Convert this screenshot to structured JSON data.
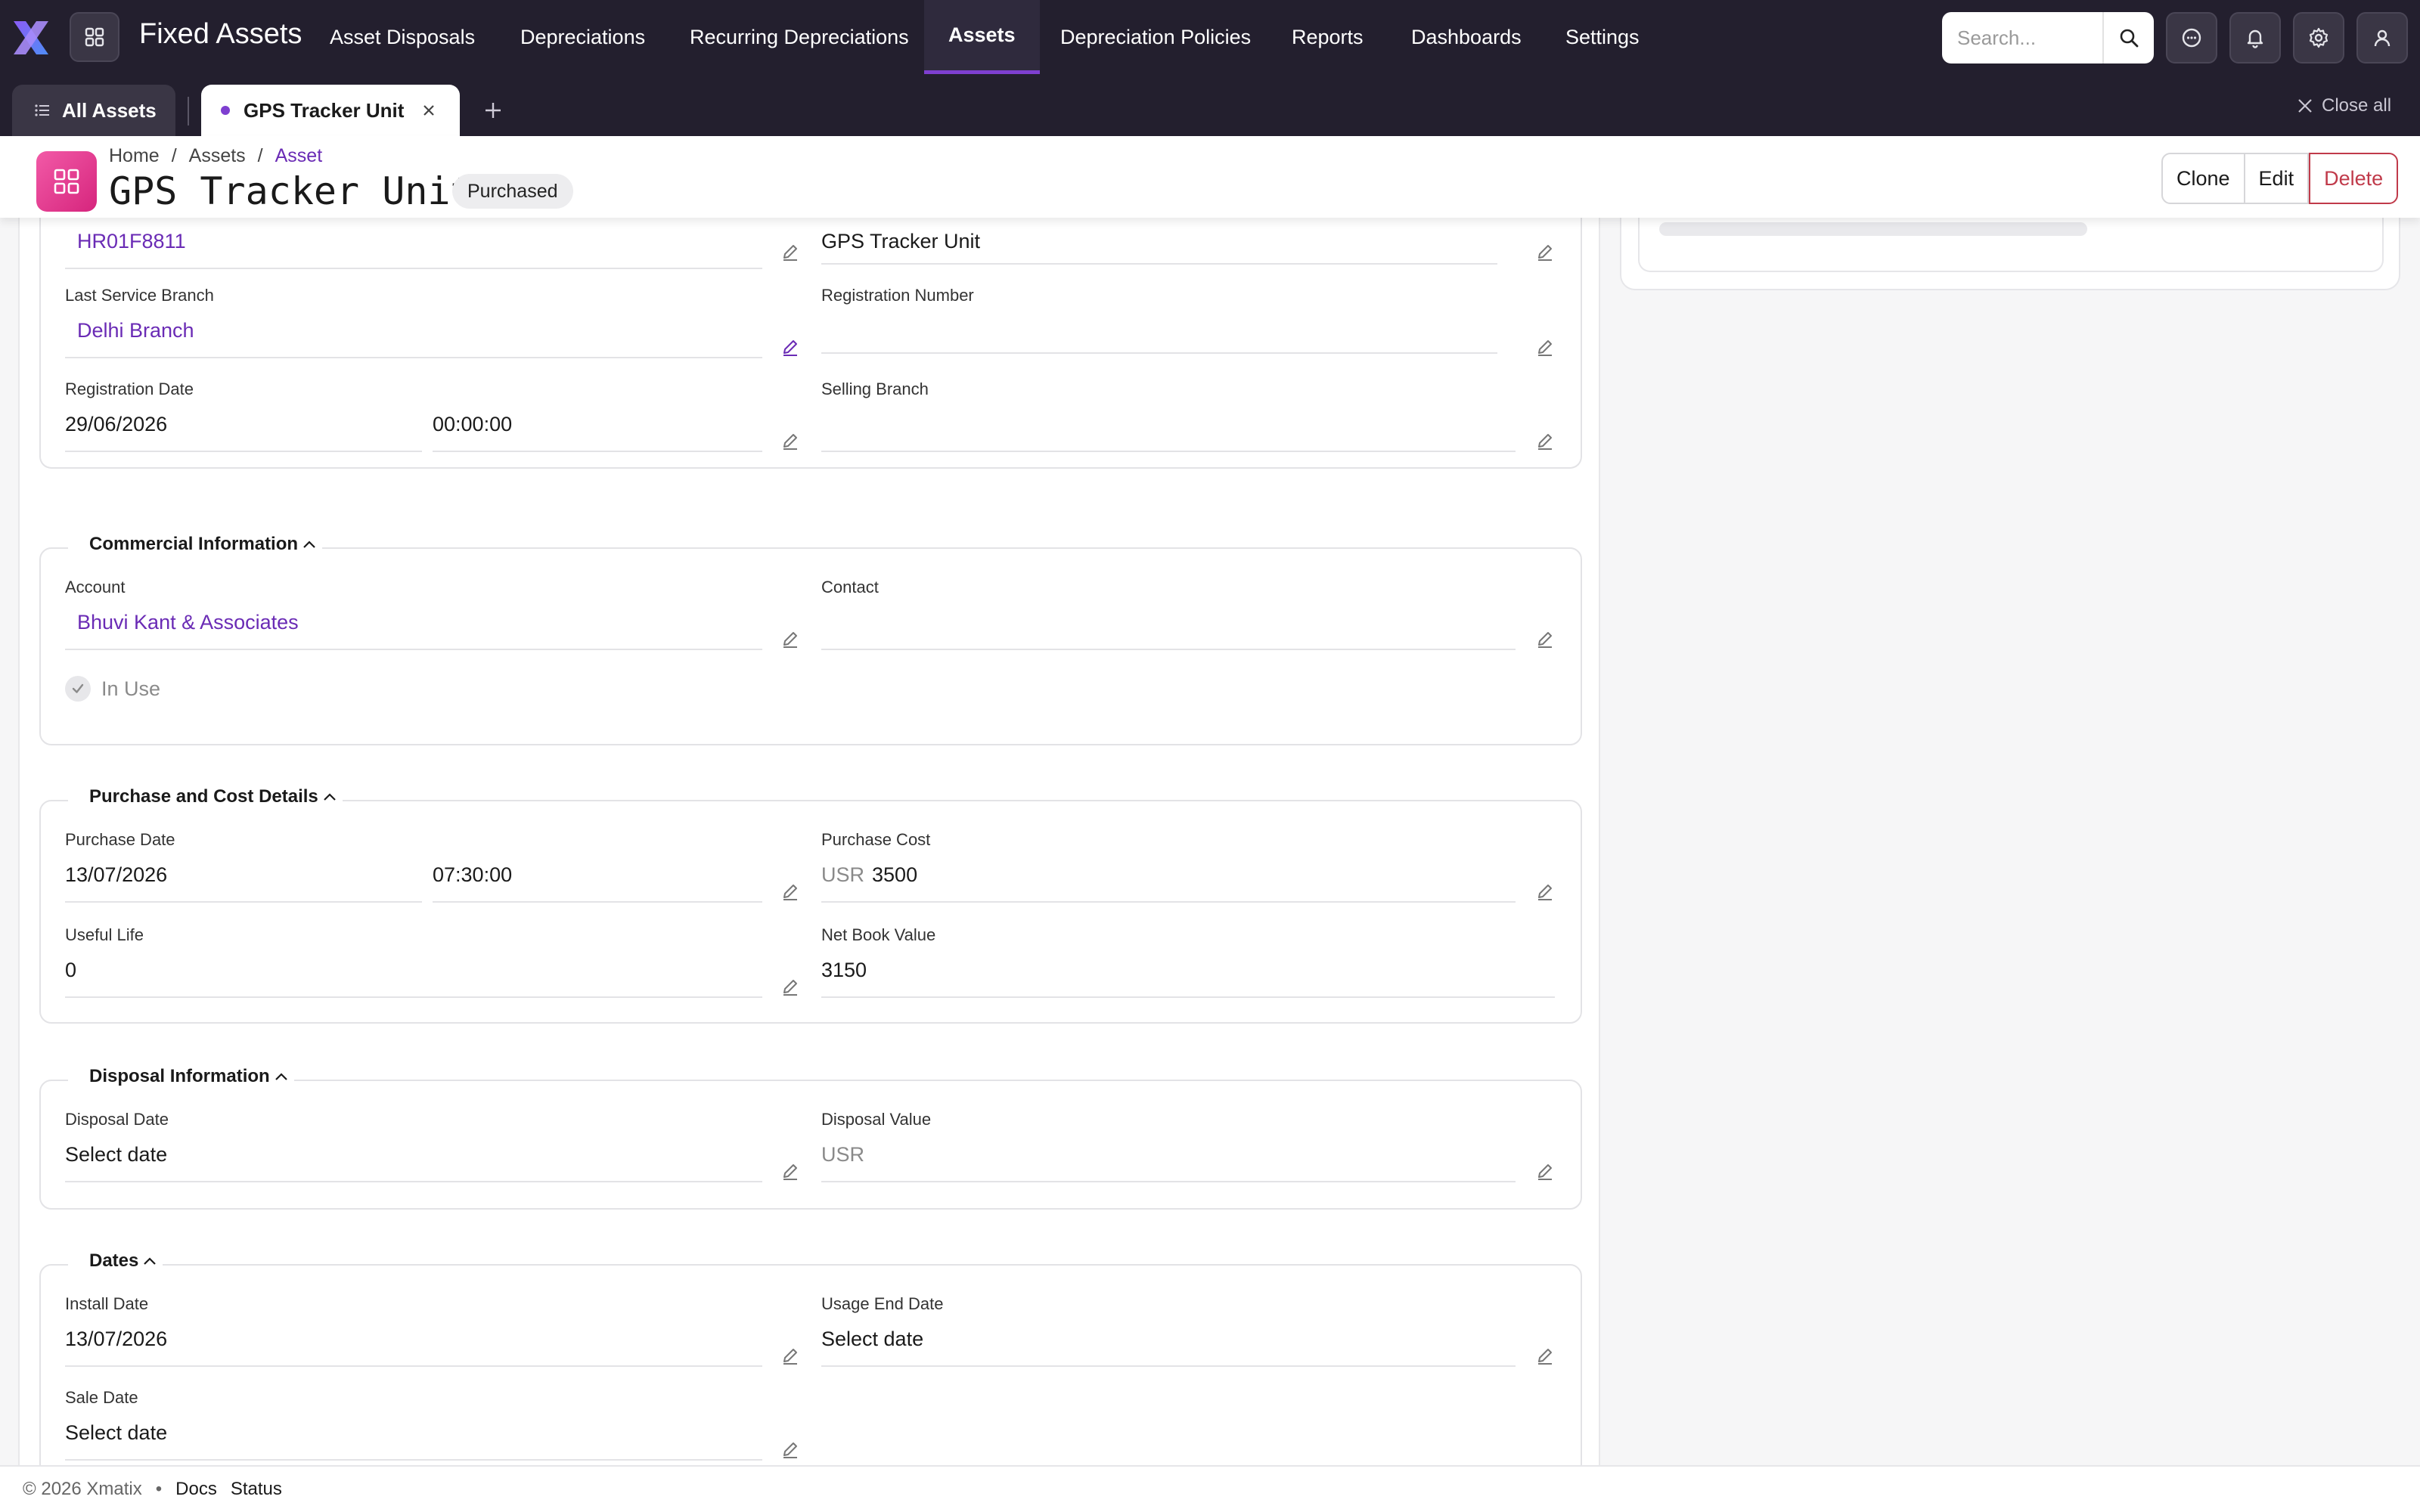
{
  "app": {
    "title": "Fixed Assets",
    "nav": [
      "Asset Disposals",
      "Depreciations",
      "Recurring Depreciations",
      "Assets",
      "Depreciation Policies",
      "Reports",
      "Dashboards",
      "Settings"
    ],
    "active_nav": "Assets",
    "search_placeholder": "Search...",
    "accent_color": "#7e3fd0",
    "icons": [
      "logo-x-icon",
      "app-grid-icon",
      "search-icon",
      "chat-icon",
      "bell-icon",
      "gear-icon",
      "user-icon"
    ]
  },
  "tabs": {
    "all_label": "All Assets",
    "current_label": "GPS Tracker Unit",
    "close_all": "Close all"
  },
  "header": {
    "breadcrumb": [
      "Home",
      "Assets",
      "Asset"
    ],
    "title": "GPS Tracker Unit",
    "status": "Purchased",
    "actions": {
      "clone": "Clone",
      "edit": "Edit",
      "delete": "Delete"
    }
  },
  "top_section": {
    "vehicle_number": "HR01F8811",
    "asset_name": "GPS Tracker Unit",
    "last_service_branch": {
      "label": "Last Service Branch",
      "value": "Delhi Branch"
    },
    "registration_number": {
      "label": "Registration Number",
      "value": ""
    },
    "registration_date": {
      "label": "Registration Date",
      "date": "29/06/2026",
      "time": "00:00:00"
    },
    "selling_branch": {
      "label": "Selling Branch",
      "value": ""
    }
  },
  "commercial": {
    "title": "Commercial Information",
    "account": {
      "label": "Account",
      "value": "Bhuvi Kant & Associates"
    },
    "contact": {
      "label": "Contact",
      "value": ""
    },
    "in_use": {
      "label": "In Use",
      "checked": true
    }
  },
  "purchase": {
    "title": "Purchase and Cost Details",
    "purchase_date": {
      "label": "Purchase Date",
      "date": "13/07/2026",
      "time": "07:30:00"
    },
    "purchase_cost": {
      "label": "Purchase Cost",
      "currency": "USR",
      "value": "3500"
    },
    "useful_life": {
      "label": "Useful Life",
      "value": "0"
    },
    "net_book_value": {
      "label": "Net Book Value",
      "value": "3150"
    }
  },
  "disposal": {
    "title": "Disposal Information",
    "disposal_date": {
      "label": "Disposal Date",
      "value": "Select date"
    },
    "disposal_value": {
      "label": "Disposal Value",
      "currency": "USR"
    }
  },
  "dates": {
    "title": "Dates",
    "install_date": {
      "label": "Install Date",
      "value": "13/07/2026"
    },
    "usage_end_date": {
      "label": "Usage End Date",
      "value": "Select date"
    },
    "sale_date": {
      "label": "Sale Date",
      "value": "Select date"
    }
  },
  "footer": {
    "copyright": "© 2026 Xmatix",
    "links": [
      "Docs",
      "Status"
    ]
  }
}
